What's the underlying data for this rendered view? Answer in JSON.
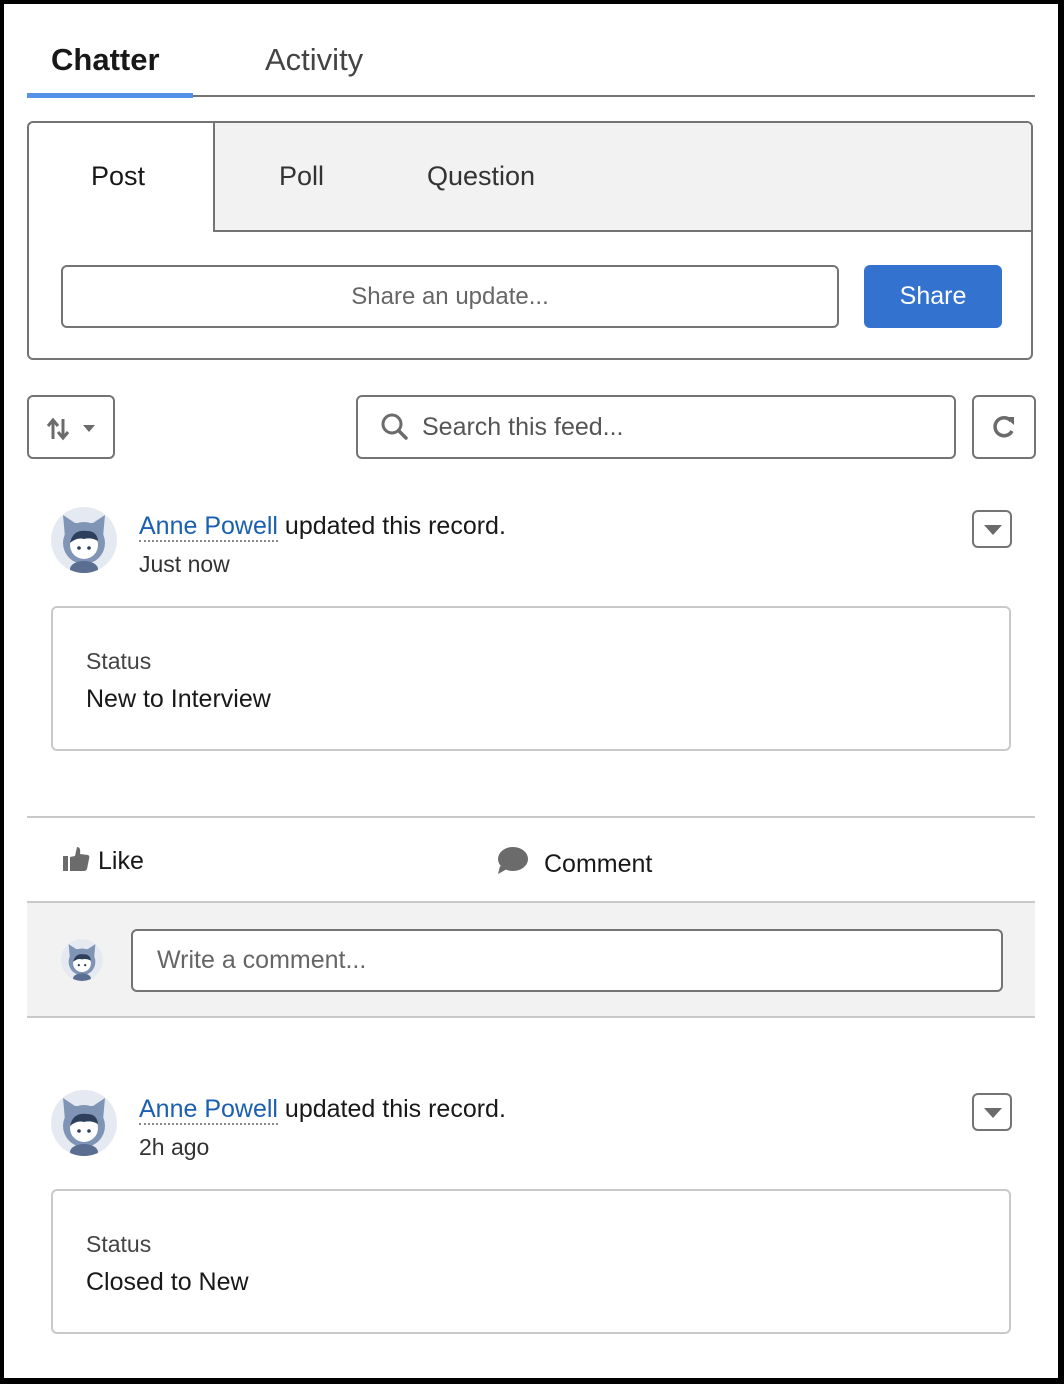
{
  "tabs": [
    {
      "label": "Chatter",
      "active": true
    },
    {
      "label": "Activity",
      "active": false
    }
  ],
  "publisher": {
    "tabs": [
      {
        "label": "Post",
        "active": true
      },
      {
        "label": "Poll",
        "active": false
      },
      {
        "label": "Question",
        "active": false
      }
    ],
    "input_placeholder": "Share an update...",
    "share_label": "Share"
  },
  "toolbar": {
    "sort_icon": "sort-arrows-icon",
    "search_placeholder": "Search this feed...",
    "refresh_icon": "refresh-icon"
  },
  "colors": {
    "accent": "#5591e8",
    "button": "#3373cf",
    "link": "#1b5fb0"
  },
  "feed": [
    {
      "author": "Anne Powell",
      "action": " updated this record.",
      "timestamp": "Just now",
      "field_label": "Status",
      "field_change": "New to Interview",
      "like_label": "Like",
      "comment_label": "Comment",
      "comment_placeholder": "Write a comment..."
    },
    {
      "author": "Anne Powell",
      "action": " updated this record.",
      "timestamp": "2h ago",
      "field_label": "Status",
      "field_change": "Closed to New"
    }
  ]
}
